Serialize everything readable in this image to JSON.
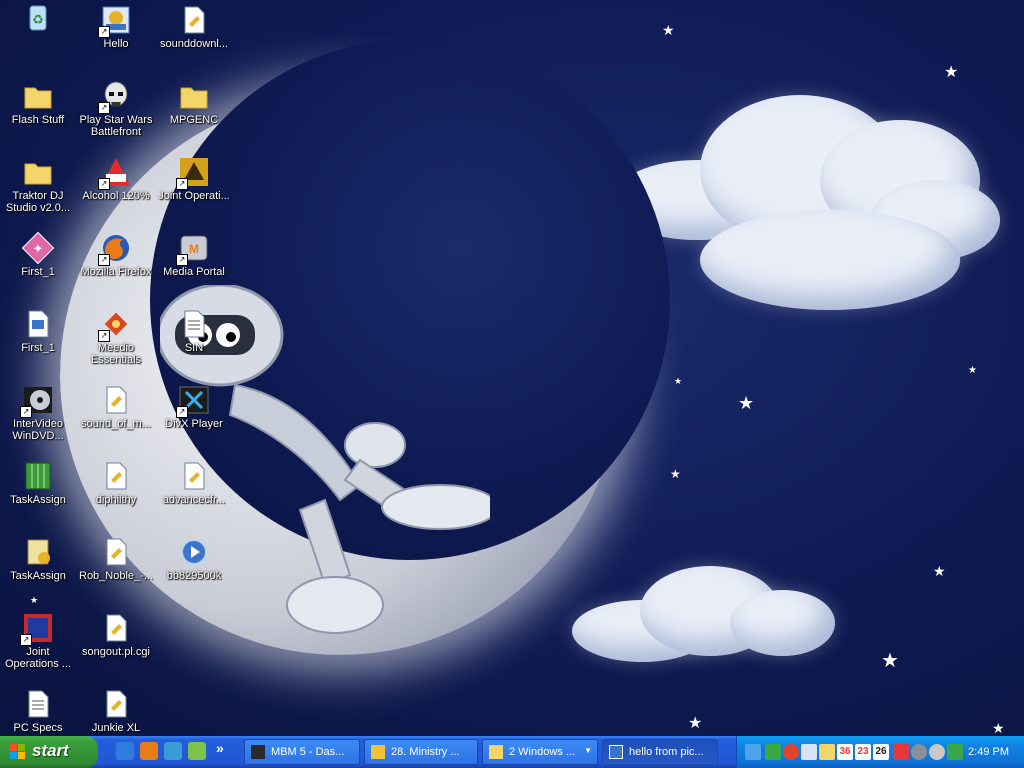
{
  "desktop": {
    "icons": [
      {
        "label": "",
        "glyph": "♻",
        "color": "#9fd3f3"
      },
      {
        "label": "Flash Stuff",
        "glyph": "",
        "color": "#f3d56a"
      },
      {
        "label": "Traktor DJ Studio v2.0...",
        "glyph": "",
        "color": "#f3d56a"
      },
      {
        "label": "First_1",
        "glyph": "✦",
        "color": "#e066a6"
      },
      {
        "label": "First_1",
        "glyph": "",
        "color": "#d9e7f7"
      },
      {
        "label": "InterVideo WinDVD...",
        "glyph": "●",
        "color": "#222"
      },
      {
        "label": "TaskAssign",
        "glyph": "▤",
        "color": "#3c9a3a"
      },
      {
        "label": "TaskAssign",
        "glyph": "✎",
        "color": "#f0e3a0"
      },
      {
        "label": "Joint Operations ...",
        "glyph": "✈",
        "color": "#c62a2a"
      },
      {
        "label": "PC Specs",
        "glyph": "≡",
        "color": "#f3f3f3"
      },
      {
        "label": "Hello",
        "glyph": "✿",
        "color": "#3b74c8"
      },
      {
        "label": "Play Star Wars Battlefront",
        "glyph": "◉",
        "color": "#e6e6e6"
      },
      {
        "label": "Alcohol 120%",
        "glyph": "A",
        "color": "#e32c2c"
      },
      {
        "label": "Mozilla Firefox",
        "glyph": "◐",
        "color": "#e87d17"
      },
      {
        "label": "Meedio Essentials",
        "glyph": "◆",
        "color": "#d9481c"
      },
      {
        "label": "sound_of_m...",
        "glyph": "",
        "color": "#d9e7f7"
      },
      {
        "label": "diphilthy",
        "glyph": "",
        "color": "#d9e7f7"
      },
      {
        "label": "Rob_Noble_-...",
        "glyph": "",
        "color": "#d9e7f7"
      },
      {
        "label": "songout.pl.cgi",
        "glyph": "",
        "color": "#d9e7f7"
      },
      {
        "label": "Junkie XL",
        "glyph": "",
        "color": "#d9e7f7"
      },
      {
        "label": "sounddownl...",
        "glyph": "",
        "color": "#d9e7f7"
      },
      {
        "label": "MPGENC",
        "glyph": "",
        "color": "#f3d56a"
      },
      {
        "label": "Joint Operati...",
        "glyph": "✈",
        "color": "#d4a21a"
      },
      {
        "label": "Media Portal",
        "glyph": "M",
        "color": "#c8ccd6"
      },
      {
        "label": "SIN",
        "glyph": "≡",
        "color": "#f3f3f3"
      },
      {
        "label": "DivX Player",
        "glyph": "X",
        "color": "#1c1c1c"
      },
      {
        "label": "advancecfr...",
        "glyph": "",
        "color": "#d9e7f7"
      },
      {
        "label": "bb829500k",
        "glyph": "▶",
        "color": "#3b74c8"
      }
    ]
  },
  "taskbar": {
    "start_label": "start",
    "quick_launch": [
      {
        "icon": "ie-icon",
        "color": "#2e7de0"
      },
      {
        "icon": "firefox-icon",
        "color": "#e87d17"
      },
      {
        "icon": "browser-icon",
        "color": "#3b9bd6"
      },
      {
        "icon": "music-icon",
        "color": "#7fc24a"
      }
    ],
    "overflow_label": "»",
    "tasks": [
      {
        "label": "MBM 5 - Das...",
        "icon_color": "#2b2b2b"
      },
      {
        "label": "28. Ministry ...",
        "icon_color": "#f2c13a"
      },
      {
        "label": "2 Windows ...",
        "icon_color": "#f3d56a"
      },
      {
        "label": "hello from pic...",
        "icon_color": "#3b74c8"
      }
    ],
    "tray_icons": [
      {
        "icon": "network-icon",
        "color": "#4fa1e8"
      },
      {
        "icon": "messenger-icon",
        "color": "#39a845"
      },
      {
        "icon": "chrome-icon",
        "color": "#e0442b"
      },
      {
        "icon": "mail-icon",
        "color": "#d9e2f2"
      },
      {
        "icon": "monitor-icon",
        "color": "#f3d56a"
      },
      {
        "icon": "sensor-icon-36",
        "color": "#e53838",
        "text": "36"
      },
      {
        "icon": "sensor-icon-23",
        "color": "#e53838",
        "text": "23"
      },
      {
        "icon": "sensor-icon-26",
        "color": "#1c1c1c",
        "text": "26"
      },
      {
        "icon": "ati-icon",
        "color": "#e53838"
      },
      {
        "icon": "speaker-icon",
        "color": "#8a8f9a"
      },
      {
        "icon": "volume-icon",
        "color": "#c9c9c9"
      },
      {
        "icon": "security-icon",
        "color": "#3aa84a"
      }
    ],
    "clock": "2:49 PM"
  }
}
